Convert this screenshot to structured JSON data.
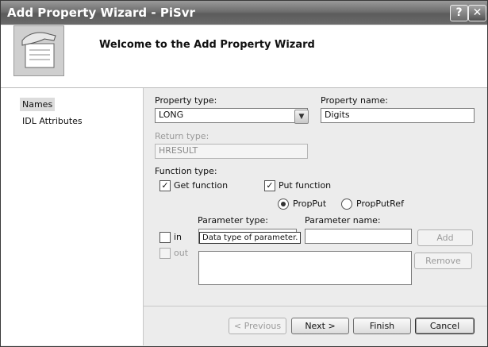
{
  "window": {
    "title": "Add Property Wizard - PiSvr",
    "help_label": "?",
    "close_label": "✕"
  },
  "header": {
    "welcome": "Welcome to the Add Property Wizard",
    "logo_icon": "wizard-hand-document-icon"
  },
  "nav": {
    "items": [
      {
        "label": "Names",
        "selected": true
      },
      {
        "label": "IDL Attributes",
        "selected": false
      }
    ]
  },
  "form": {
    "property_type_label": "Property type:",
    "property_type_value": "LONG",
    "property_name_label": "Property name:",
    "property_name_value": "Digits",
    "return_type_label": "Return type:",
    "return_type_value": "HRESULT",
    "function_type_label": "Function type:",
    "get_function_label": "Get function",
    "get_function_checked": true,
    "put_function_label": "Put function",
    "put_function_checked": true,
    "propput_label": "PropPut",
    "propputref_label": "PropPutRef",
    "parameter_type_label": "Parameter type:",
    "parameter_name_label": "Parameter name:",
    "in_label": "in",
    "out_label": "out",
    "tooltip": "Data type of parameter.",
    "add_label": "Add",
    "remove_label": "Remove"
  },
  "footer": {
    "previous_label": "< Previous",
    "next_label": "Next >",
    "finish_label": "Finish",
    "cancel_label": "Cancel"
  }
}
